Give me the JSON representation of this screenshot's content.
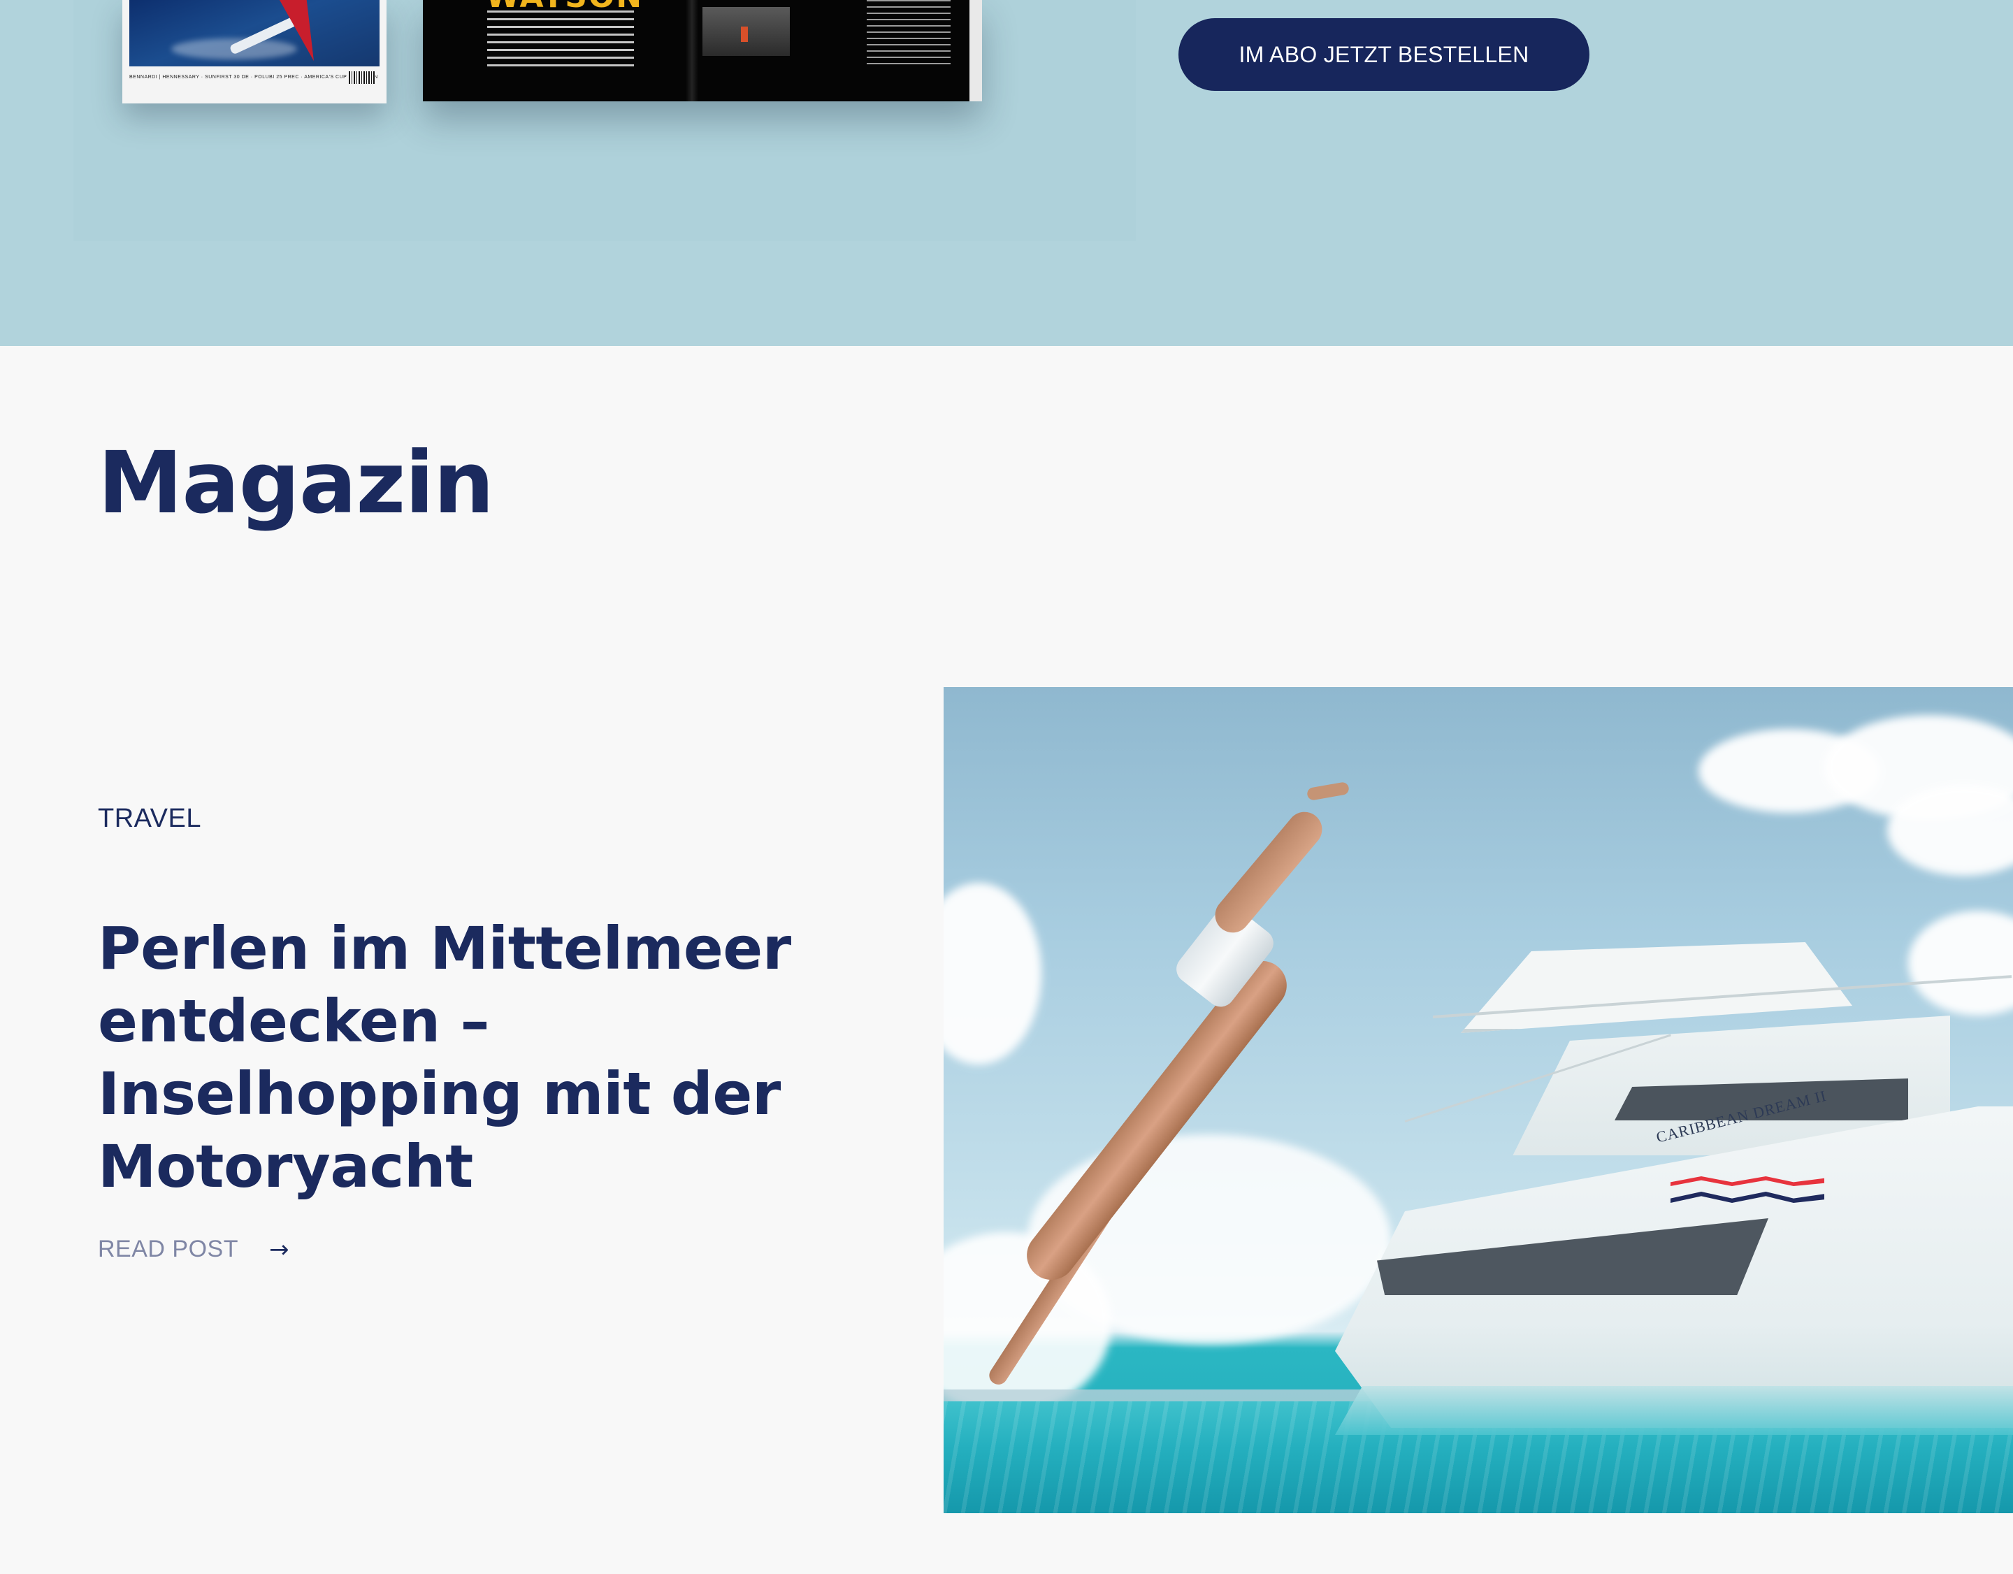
{
  "promo": {
    "cta_label": "IM ABO JETZT BESTELLEN",
    "magazine_spread_headline": "WATSON",
    "cover_strip_text": "BENNARDI | HENNESSARY · SUNFIRST 30 DE · POLUBI 25 PREC · AMERICA'S CUP · BRETAGN"
  },
  "magazine": {
    "section_title": "Magazin",
    "post": {
      "category": "TRAVEL",
      "title": "Perlen im Mittelmeer entdecken – Inselhopping mit der Motoryacht",
      "read_more_label": "READ POST",
      "arrow_glyph": "→",
      "image_alt_yacht_name": "CARIBBEAN DREAM II"
    }
  },
  "colors": {
    "navy": "#17265c",
    "promo_bg": "#b1d3dc",
    "page_bg": "#f8f8f8",
    "muted_link": "#7f86a5"
  }
}
